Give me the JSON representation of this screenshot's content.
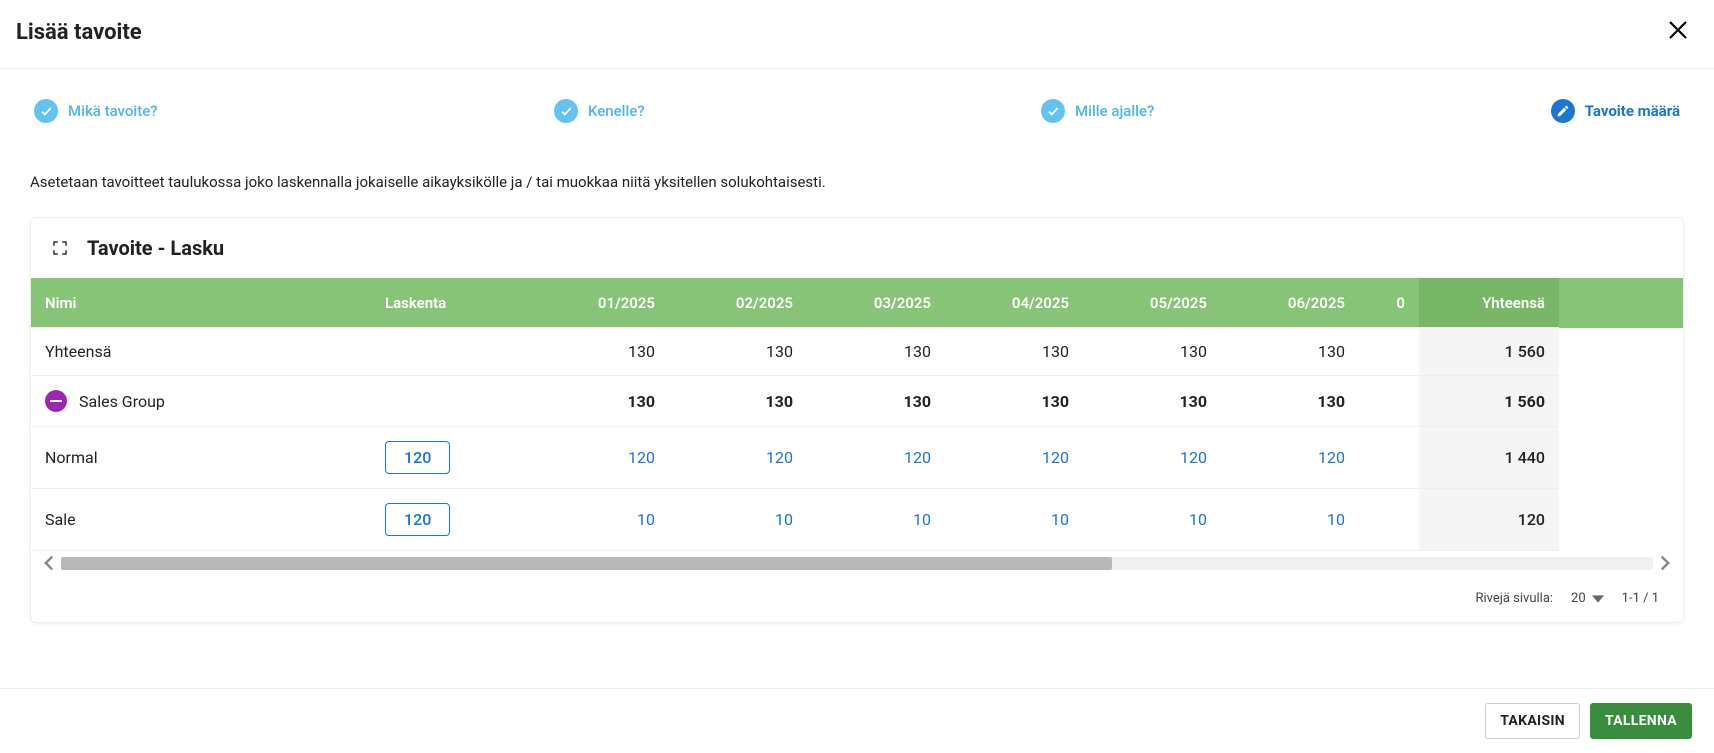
{
  "header": {
    "title": "Lisää tavoite"
  },
  "stepper": {
    "s1": "Mikä tavoite?",
    "s2": "Kenelle?",
    "s3": "Mille ajalle?",
    "s4": "Tavoite määrä"
  },
  "description": "Asetetaan tavoitteet taulukossa joko laskennalla jokaiselle aikayksikölle ja / tai muokkaa niitä yksitellen solukohtaisesti.",
  "card": {
    "title": "Tavoite - Lasku"
  },
  "table": {
    "columns": {
      "name": "Nimi",
      "calc": "Laskenta",
      "m1": "01/2025",
      "m2": "02/2025",
      "m3": "03/2025",
      "m4": "04/2025",
      "m5": "05/2025",
      "m6": "06/2025",
      "m7cut": "0",
      "total": "Yhteensä"
    },
    "rows": {
      "total": {
        "name": "Yhteensä",
        "calc": "",
        "m1": "130",
        "m2": "130",
        "m3": "130",
        "m4": "130",
        "m5": "130",
        "m6": "130",
        "total": "1 560"
      },
      "group": {
        "name": "Sales Group",
        "calc": "",
        "m1": "130",
        "m2": "130",
        "m3": "130",
        "m4": "130",
        "m5": "130",
        "m6": "130",
        "total": "1 560"
      },
      "normal": {
        "name": "Normal",
        "calc": "120",
        "m1": "120",
        "m2": "120",
        "m3": "120",
        "m4": "120",
        "m5": "120",
        "m6": "120",
        "total": "1 440"
      },
      "sale": {
        "name": "Sale",
        "calc": "120",
        "m1": "10",
        "m2": "10",
        "m3": "10",
        "m4": "10",
        "m5": "10",
        "m6": "10",
        "total": "120"
      }
    }
  },
  "pager": {
    "rowsLabel": "Rivejä sivulla:",
    "rowsValue": "20",
    "range": "1-1 / 1"
  },
  "footer": {
    "back": "TAKAISIN",
    "save": "TALLENNA"
  }
}
